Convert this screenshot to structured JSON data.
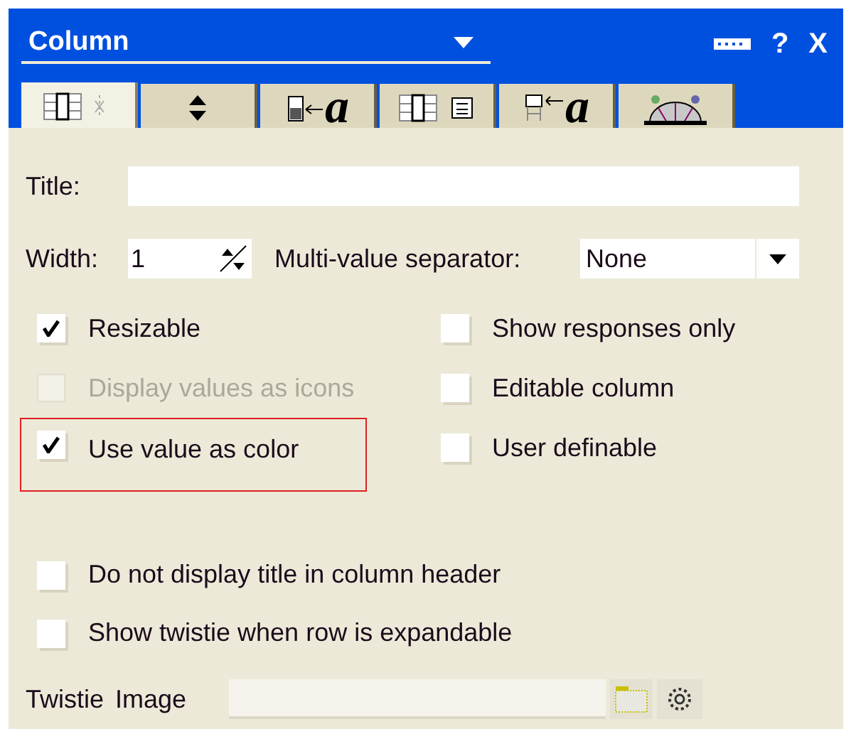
{
  "window": {
    "title": "Column",
    "help": "?",
    "close": "X"
  },
  "tabs": [
    {
      "kind": "column-info",
      "selected": true
    },
    {
      "kind": "sort",
      "selected": false
    },
    {
      "kind": "font",
      "glyph": "a",
      "selected": false
    },
    {
      "kind": "number",
      "selected": false
    },
    {
      "kind": "title-font",
      "glyph": "a",
      "selected": false
    },
    {
      "kind": "advanced",
      "selected": false
    }
  ],
  "title_field": {
    "label": "Title:"
  },
  "width_field": {
    "label": "Width:",
    "value": "1"
  },
  "separator": {
    "label": "Multi-value separator:",
    "value": "None"
  },
  "options": [
    {
      "label": "Resizable",
      "checked": true,
      "disabled": false,
      "highlighted": false
    },
    {
      "label": "Show responses only",
      "checked": false,
      "disabled": false,
      "highlighted": false
    },
    {
      "label": "Display values as icons",
      "checked": false,
      "disabled": true,
      "highlighted": false
    },
    {
      "label": "Editable column",
      "checked": false,
      "disabled": false,
      "highlighted": false
    },
    {
      "label": "Use value as color",
      "checked": true,
      "disabled": false,
      "highlighted": true
    },
    {
      "label": "User definable",
      "checked": false,
      "disabled": false,
      "highlighted": false
    }
  ],
  "header_options": [
    {
      "label": "Do not display title in column header",
      "checked": false
    },
    {
      "label": "Show twistie when row is expandable",
      "checked": false
    }
  ],
  "twistie": {
    "label_1": "Twistie",
    "label_2": "Image"
  }
}
